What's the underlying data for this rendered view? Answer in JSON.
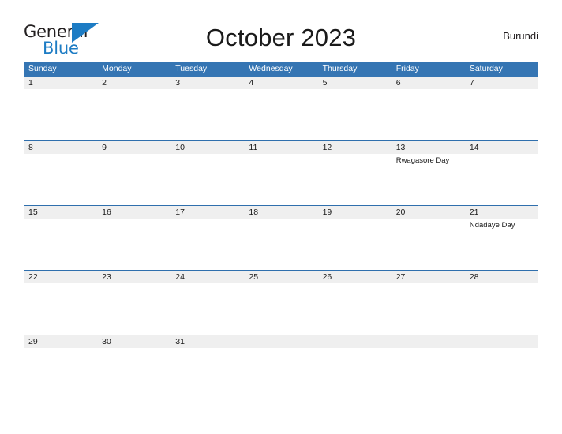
{
  "brand": {
    "name_top": "General",
    "name_bottom": "Blue",
    "flag_icon": "triangle-flag-icon",
    "color_top": "#231f20",
    "color_bottom": "#1d7cc4"
  },
  "header": {
    "title": "October 2023",
    "country": "Burundi"
  },
  "colors": {
    "header_blue": "#3575b3",
    "row_divider": "#2f6fad",
    "daynum_band": "#efefef",
    "text": "#1a1a1a"
  },
  "calendar": {
    "month": "October",
    "year": "2023",
    "weekday_headers": [
      "Sunday",
      "Monday",
      "Tuesday",
      "Wednesday",
      "Thursday",
      "Friday",
      "Saturday"
    ],
    "weeks": [
      [
        {
          "day": "1",
          "events": []
        },
        {
          "day": "2",
          "events": []
        },
        {
          "day": "3",
          "events": []
        },
        {
          "day": "4",
          "events": []
        },
        {
          "day": "5",
          "events": []
        },
        {
          "day": "6",
          "events": []
        },
        {
          "day": "7",
          "events": []
        }
      ],
      [
        {
          "day": "8",
          "events": []
        },
        {
          "day": "9",
          "events": []
        },
        {
          "day": "10",
          "events": []
        },
        {
          "day": "11",
          "events": []
        },
        {
          "day": "12",
          "events": []
        },
        {
          "day": "13",
          "events": [
            "Rwagasore Day"
          ]
        },
        {
          "day": "14",
          "events": []
        }
      ],
      [
        {
          "day": "15",
          "events": []
        },
        {
          "day": "16",
          "events": []
        },
        {
          "day": "17",
          "events": []
        },
        {
          "day": "18",
          "events": []
        },
        {
          "day": "19",
          "events": []
        },
        {
          "day": "20",
          "events": []
        },
        {
          "day": "21",
          "events": [
            "Ndadaye Day"
          ]
        }
      ],
      [
        {
          "day": "22",
          "events": []
        },
        {
          "day": "23",
          "events": []
        },
        {
          "day": "24",
          "events": []
        },
        {
          "day": "25",
          "events": []
        },
        {
          "day": "26",
          "events": []
        },
        {
          "day": "27",
          "events": []
        },
        {
          "day": "28",
          "events": []
        }
      ],
      [
        {
          "day": "29",
          "events": []
        },
        {
          "day": "30",
          "events": []
        },
        {
          "day": "31",
          "events": []
        },
        {
          "day": "",
          "events": []
        },
        {
          "day": "",
          "events": []
        },
        {
          "day": "",
          "events": []
        },
        {
          "day": "",
          "events": []
        }
      ]
    ]
  }
}
